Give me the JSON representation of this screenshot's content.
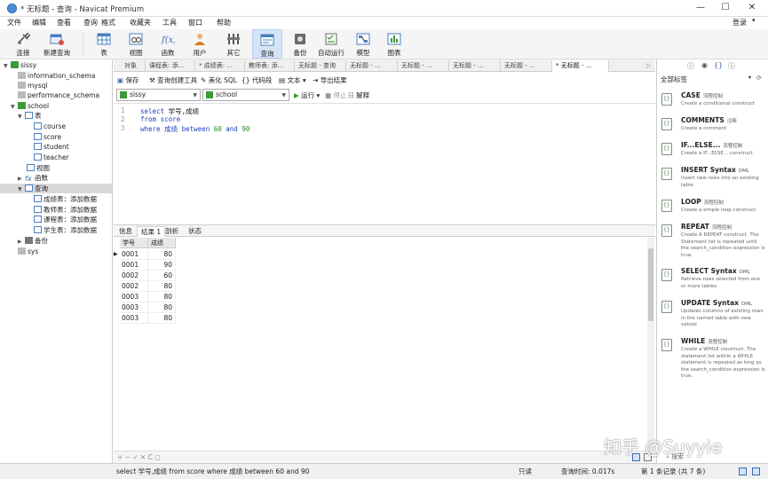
{
  "window": {
    "title": "* 无标题 - 查询 - Navicat Premium"
  },
  "menu": {
    "items": [
      "文件",
      "编辑",
      "查看",
      "查询",
      "格式",
      "收藏夹",
      "工具",
      "窗口",
      "帮助"
    ],
    "login": "登录"
  },
  "toolbar": {
    "buttons": [
      "连接",
      "新建查询",
      "表",
      "视图",
      "函数",
      "用户",
      "其它",
      "查询",
      "备份",
      "自动运行",
      "模型",
      "图表"
    ]
  },
  "tree": {
    "sissy": "sissy",
    "information_schema": "information_schema",
    "mysql": "mysql",
    "performance_schema": "performance_schema",
    "school": "school",
    "tables": "表",
    "t_course": "course",
    "t_score": "score",
    "t_student": "student",
    "t_teacher": "teacher",
    "views": "视图",
    "functions": "函数",
    "queries": "查询",
    "q1": "成绩表：添加数据",
    "q2": "教师表：添加数据",
    "q3": "课程表：添加数据",
    "q4": "学生表：添加数据",
    "backup": "备份",
    "sys": "sys"
  },
  "tabs": [
    "对象",
    "课程表: 添...",
    "* 成绩表: ...",
    "教师表: 添...",
    "无标题 - 查询",
    "无标题 - ...",
    "无标题 - ...",
    "无标题 - ...",
    "无标题 - ...",
    "* 无标题 - ..."
  ],
  "query_toolbar": {
    "save": "保存",
    "builder": "查询创建工具",
    "beautify": "美化 SQL",
    "snippet": "代码段",
    "text": "文本",
    "export": "导出结果"
  },
  "selectors": {
    "connection": "sissy",
    "database": "school",
    "run": "运行",
    "stop": "停止",
    "explain": "解释"
  },
  "editor": {
    "lines": [
      "1",
      "2",
      "3"
    ]
  },
  "result_tabs": [
    "信息",
    "结果 1",
    "剖析",
    "状态"
  ],
  "grid": {
    "columns": [
      "学号",
      "成绩"
    ],
    "rows": [
      [
        "0001",
        "80"
      ],
      [
        "0001",
        "90"
      ],
      [
        "0002",
        "60"
      ],
      [
        "0002",
        "80"
      ],
      [
        "0003",
        "80"
      ],
      [
        "0003",
        "80"
      ],
      [
        "0003",
        "80"
      ]
    ]
  },
  "grid_footer": "+ − ✓ ✕ C ◻",
  "right_panel": {
    "filter": "全部标签",
    "snippets": [
      {
        "title": "CASE",
        "tag": "流程控制",
        "desc": "Create a conditional construct"
      },
      {
        "title": "COMMENTS",
        "tag": "注释",
        "desc": "Create a comment"
      },
      {
        "title": "IF...ELSE...",
        "tag": "流程控制",
        "desc": "Create a IF...ELSE... construct"
      },
      {
        "title": "INSERT Syntax",
        "tag": "DML",
        "desc": "Insert new rows into an existing table"
      },
      {
        "title": "LOOP",
        "tag": "流程控制",
        "desc": "Create a simple loop construct"
      },
      {
        "title": "REPEAT",
        "tag": "流程控制",
        "desc": "Create A REPEAT construct. The Statement list is repeated until the search_condition expression is true."
      },
      {
        "title": "SELECT Syntax",
        "tag": "DML",
        "desc": "Retrieve rows selected from one or more tables"
      },
      {
        "title": "UPDATE Syntax",
        "tag": "DML",
        "desc": "Updates columns of existing rows in the named table with new values"
      },
      {
        "title": "WHILE",
        "tag": "流程控制",
        "desc": "Create a WHILE construct. The statement list within a WHILE statement is repeated as long as the search_condition expression is true."
      }
    ],
    "search_placeholder": "搜索"
  },
  "status": {
    "sql": "select 学号,成绩 from score where 成绩 between 60 and 90",
    "mode": "只读",
    "time": "查询时间: 0.017s",
    "records": "第 1 条记录 (共 7 条)"
  },
  "watermark": "知乎 @Suyyie"
}
